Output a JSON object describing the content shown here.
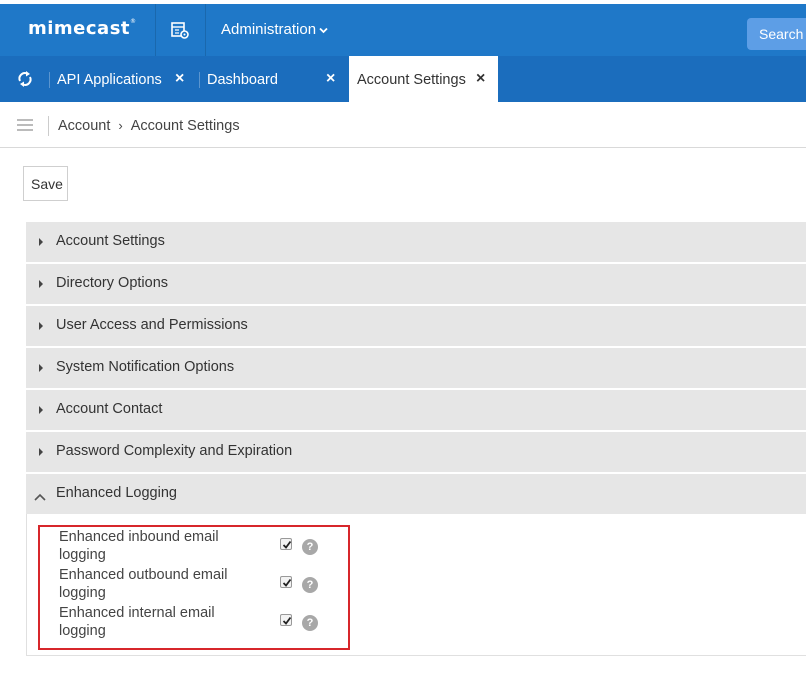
{
  "header": {
    "logo": "mimecast",
    "logo_mark": "®",
    "app_icon": "apps-settings-icon",
    "admin_menu_label": "Administration",
    "search_label": "Search",
    "brand_color": "#1f78c8"
  },
  "tabs": [
    {
      "label": "API Applications",
      "close": "×",
      "active": false
    },
    {
      "label": "Dashboard",
      "close": "×",
      "active": false
    },
    {
      "label": "Account Settings",
      "close": "×",
      "active": true
    }
  ],
  "breadcrumb": {
    "root": "Account",
    "separator": "›",
    "current": "Account Settings"
  },
  "toolbar": {
    "save_label": "Save"
  },
  "sections": [
    {
      "label": "Account Settings",
      "expanded": false
    },
    {
      "label": "Directory Options",
      "expanded": false
    },
    {
      "label": "User Access and Permissions",
      "expanded": false
    },
    {
      "label": "System Notification Options",
      "expanded": false
    },
    {
      "label": "Account Contact",
      "expanded": false
    },
    {
      "label": "Password Complexity and Expiration",
      "expanded": false
    },
    {
      "label": "Enhanced Logging",
      "expanded": true
    }
  ],
  "enhanced_logging": {
    "options": [
      {
        "label": "Enhanced inbound email logging",
        "checked": true,
        "help": "?"
      },
      {
        "label": "Enhanced outbound email logging",
        "checked": true,
        "help": "?"
      },
      {
        "label": "Enhanced internal email logging",
        "checked": true,
        "help": "?"
      }
    ]
  },
  "highlight_color": "#d7262b"
}
